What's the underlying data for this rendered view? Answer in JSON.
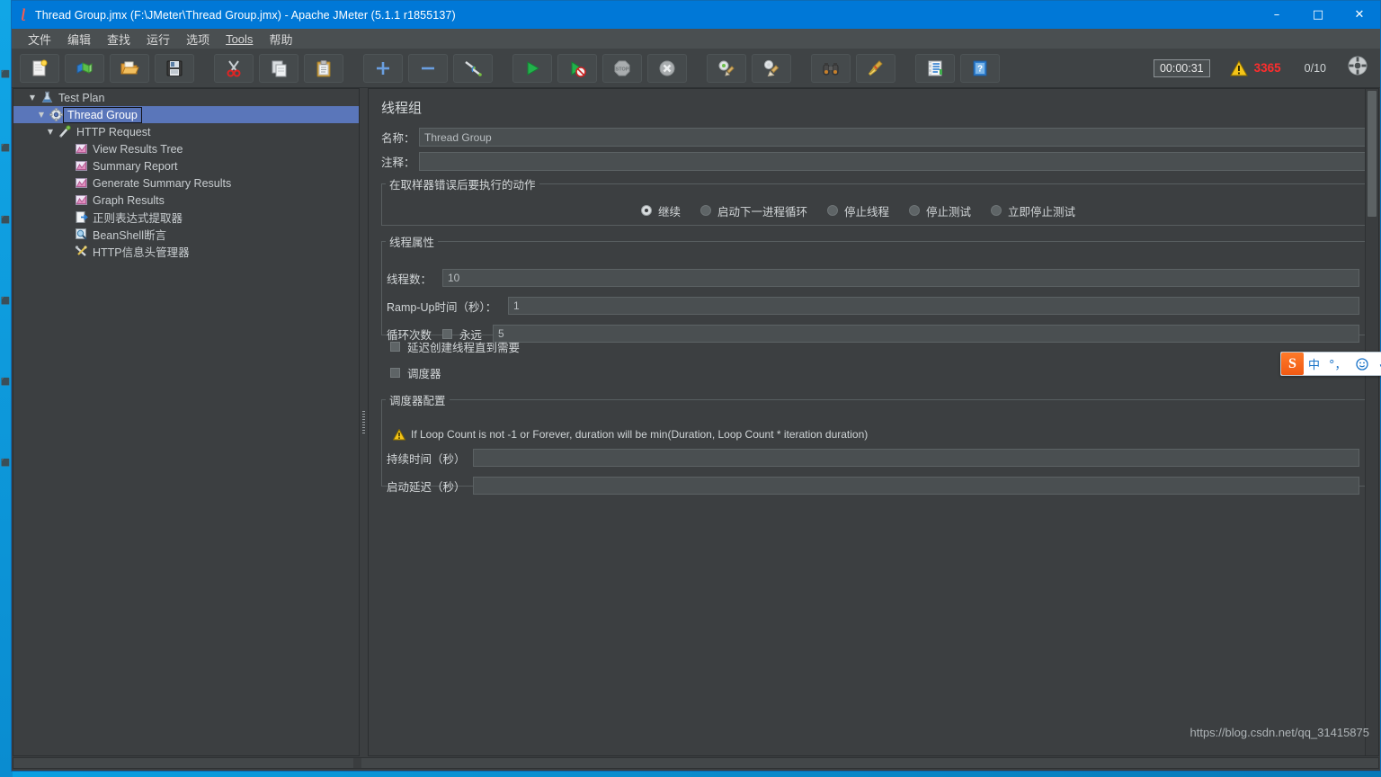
{
  "window": {
    "title": "Thread Group.jmx (F:\\JMeter\\Thread Group.jmx) - Apache JMeter (5.1.1 r1855137)",
    "app_icon": "jmeter-feather-icon",
    "minimize": "–",
    "maximize": "□",
    "close": "✕",
    "titlebar_color": "#0078d7"
  },
  "menubar": {
    "items": [
      {
        "label": "文件",
        "name": "menu-file"
      },
      {
        "label": "编辑",
        "name": "menu-edit"
      },
      {
        "label": "查找",
        "name": "menu-search"
      },
      {
        "label": "运行",
        "name": "menu-run"
      },
      {
        "label": "选项",
        "name": "menu-options"
      },
      {
        "label": "Tools",
        "name": "menu-tools",
        "mnemonic": true
      },
      {
        "label": "帮助",
        "name": "menu-help"
      }
    ]
  },
  "toolbar": {
    "buttons": [
      {
        "name": "new-button",
        "icon": "new-document-icon"
      },
      {
        "name": "templates-button",
        "icon": "templates-books-icon"
      },
      {
        "name": "open-button",
        "icon": "open-folder-icon"
      },
      {
        "name": "save-button",
        "icon": "floppy-save-icon"
      },
      {
        "name": "cut-button",
        "icon": "scissors-cut-icon"
      },
      {
        "name": "copy-button",
        "icon": "copy-pages-icon"
      },
      {
        "name": "paste-button",
        "icon": "clipboard-paste-icon"
      },
      {
        "name": "expand-all-button",
        "icon": "plus-icon"
      },
      {
        "name": "collapse-all-button",
        "icon": "minus-icon"
      },
      {
        "name": "toggle-button",
        "icon": "toggle-pencils-icon"
      },
      {
        "name": "start-button",
        "icon": "green-play-icon"
      },
      {
        "name": "start-no-pauses-button",
        "icon": "play-no-pause-icon"
      },
      {
        "name": "stop-button",
        "icon": "stop-sign-icon"
      },
      {
        "name": "shutdown-button",
        "icon": "shutdown-x-icon"
      },
      {
        "name": "clear-button",
        "icon": "gear-broom-icon"
      },
      {
        "name": "clear-all-button",
        "icon": "broom-all-icon"
      },
      {
        "name": "search-button",
        "icon": "binoculars-icon"
      },
      {
        "name": "reset-search-button",
        "icon": "yellow-broom-icon"
      },
      {
        "name": "function-helper-button",
        "icon": "notepad-list-icon"
      },
      {
        "name": "help-button",
        "icon": "blue-help-book-icon"
      }
    ],
    "elapsed_time": "00:00:31",
    "warning_icon": "warning-triangle-icon",
    "warning_count": "3365",
    "warning_color": "#ff2d2d",
    "thread_counter": "0/10",
    "reset_icon": "reset-crosshair-icon"
  },
  "tree": {
    "items": [
      {
        "label": "Test Plan",
        "name": "tree-item-test-plan",
        "depth": 0,
        "twisty": "▼",
        "icon": "test-plan-icon",
        "selected": false
      },
      {
        "label": "Thread Group",
        "name": "tree-item-thread-group",
        "depth": 1,
        "twisty": "▼",
        "icon": "thread-group-gear-icon",
        "selected": true
      },
      {
        "label": "HTTP Request",
        "name": "tree-item-http-request",
        "depth": 2,
        "twisty": "▼",
        "icon": "http-request-pencil-icon",
        "selected": false
      },
      {
        "label": "View Results Tree",
        "name": "tree-item-view-results-tree",
        "depth": 3,
        "twisty": "",
        "icon": "listener-chart-icon",
        "selected": false
      },
      {
        "label": "Summary Report",
        "name": "tree-item-summary-report",
        "depth": 3,
        "twisty": "",
        "icon": "listener-chart-icon",
        "selected": false
      },
      {
        "label": "Generate Summary Results",
        "name": "tree-item-generate-summary",
        "depth": 3,
        "twisty": "",
        "icon": "listener-chart-icon",
        "selected": false
      },
      {
        "label": "Graph Results",
        "name": "tree-item-graph-results",
        "depth": 3,
        "twisty": "",
        "icon": "listener-chart-icon",
        "selected": false
      },
      {
        "label": "正则表达式提取器",
        "name": "tree-item-regex-extractor",
        "depth": 3,
        "twisty": "",
        "icon": "post-processor-icon",
        "selected": false
      },
      {
        "label": "BeanShell断言",
        "name": "tree-item-beanshell-assertion",
        "depth": 3,
        "twisty": "",
        "icon": "assertion-magnifier-icon",
        "selected": false
      },
      {
        "label": "HTTP信息头管理器",
        "name": "tree-item-http-header-manager",
        "depth": 3,
        "twisty": "",
        "icon": "config-wrench-icon",
        "selected": false
      }
    ]
  },
  "main": {
    "panel_title": "线程组",
    "name_label": "名称：",
    "name_value": "Thread Group",
    "comment_label": "注释：",
    "comment_value": "",
    "on_error": {
      "legend": "在取样器错误后要执行的动作",
      "options": [
        {
          "label": "继续",
          "name": "radio-continue",
          "selected": true
        },
        {
          "label": "启动下一进程循环",
          "name": "radio-start-next-loop",
          "selected": false
        },
        {
          "label": "停止线程",
          "name": "radio-stop-thread",
          "selected": false
        },
        {
          "label": "停止测试",
          "name": "radio-stop-test",
          "selected": false
        },
        {
          "label": "立即停止测试",
          "name": "radio-stop-test-now",
          "selected": false
        }
      ]
    },
    "thread_props": {
      "legend": "线程属性",
      "threads_label": "线程数：",
      "threads_value": "10",
      "rampup_label": "Ramp-Up时间（秒）：",
      "rampup_value": "1",
      "loops_label": "循环次数",
      "forever_label": "永远",
      "forever_checked": false,
      "loops_value": "5",
      "delay_create_label": "延迟创建线程直到需要",
      "delay_create_checked": false,
      "scheduler_label": "调度器",
      "scheduler_checked": false
    },
    "scheduler_config": {
      "legend": "调度器配置",
      "warning_icon": "warning-triangle-icon",
      "warning_text": "If Loop Count is not -1 or Forever, duration will be min(Duration, Loop Count * iteration duration)",
      "duration_label": "持续时间（秒）",
      "duration_value": "",
      "startup_delay_label": "启动延迟（秒）",
      "startup_delay_value": ""
    }
  },
  "ime": {
    "logo": "S",
    "items": [
      {
        "label": "中",
        "name": "ime-chinese-mode-button"
      },
      {
        "label": "°，",
        "name": "ime-punctuation-button"
      },
      {
        "label": "☺",
        "name": "ime-emoji-button"
      },
      {
        "label": "⬡",
        "name": "ime-voice-input-button"
      }
    ]
  },
  "watermark": "https://blog.csdn.net/qq_31415875"
}
